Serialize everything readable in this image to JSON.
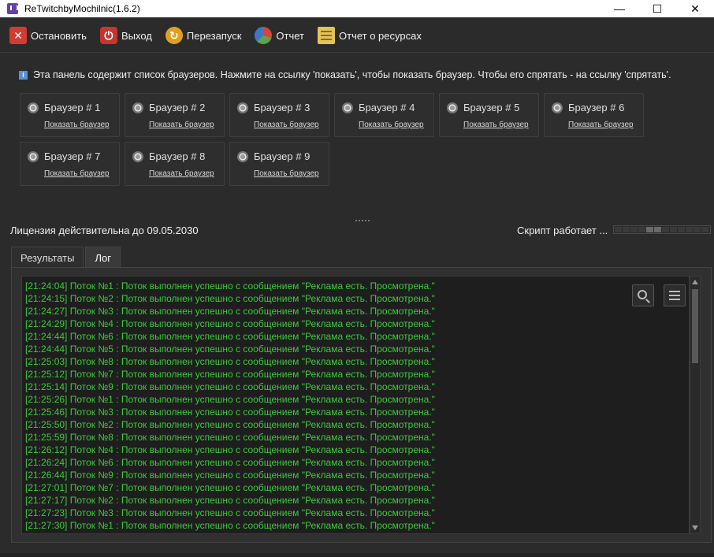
{
  "window": {
    "title": "ReTwitchbyMochilnic(1.6.2)",
    "controls": {
      "minimize": "—",
      "maximize": "☐",
      "close": "✕"
    }
  },
  "toolbar": {
    "stop": "Остановить",
    "exit": "Выход",
    "restart": "Перезапуск",
    "report": "Отчет",
    "resources": "Отчет о ресурсах"
  },
  "info": {
    "text": "Эта панель содержит список браузеров. Нажмите на ссылку 'показать', чтобы показать браузер. Чтобы его спрятать - на ссылку 'спрятать'."
  },
  "browsers": [
    {
      "name": "Браузер # 1",
      "link": "Показать браузер"
    },
    {
      "name": "Браузер # 2",
      "link": "Показать браузер"
    },
    {
      "name": "Браузер # 3",
      "link": "Показать браузер"
    },
    {
      "name": "Браузер # 4",
      "link": "Показать браузер"
    },
    {
      "name": "Браузер # 5",
      "link": "Показать браузер"
    },
    {
      "name": "Браузер # 6",
      "link": "Показать браузер"
    },
    {
      "name": "Браузер # 7",
      "link": "Показать браузер"
    },
    {
      "name": "Браузер # 8",
      "link": "Показать браузер"
    },
    {
      "name": "Браузер # 9",
      "link": "Показать браузер"
    }
  ],
  "status": {
    "license": "Лицензия действительна до 09.05.2030",
    "script": "Скрипт работает ..."
  },
  "tabs": [
    {
      "label": "Результаты",
      "active": false
    },
    {
      "label": "Лог",
      "active": true
    }
  ],
  "log": [
    "[21:24:04] Поток №1 : Поток выполнен успешно с сообщением \"Реклама есть. Просмотрена.\"",
    "[21:24:15] Поток №2 : Поток выполнен успешно с сообщением \"Реклама есть. Просмотрена.\"",
    "[21:24:27] Поток №3 : Поток выполнен успешно с сообщением \"Реклама есть. Просмотрена.\"",
    "[21:24:29] Поток №4 : Поток выполнен успешно с сообщением \"Реклама есть. Просмотрена.\"",
    "[21:24:44] Поток №6 : Поток выполнен успешно с сообщением \"Реклама есть. Просмотрена.\"",
    "[21:24:44] Поток №5 : Поток выполнен успешно с сообщением \"Реклама есть. Просмотрена.\"",
    "[21:25:03] Поток №8 : Поток выполнен успешно с сообщением \"Реклама есть. Просмотрена.\"",
    "[21:25:12] Поток №7 : Поток выполнен успешно с сообщением \"Реклама есть. Просмотрена.\"",
    "[21:25:14] Поток №9 : Поток выполнен успешно с сообщением \"Реклама есть. Просмотрена.\"",
    "[21:25:26] Поток №1 : Поток выполнен успешно с сообщением \"Реклама есть. Просмотрена.\"",
    "[21:25:46] Поток №3 : Поток выполнен успешно с сообщением \"Реклама есть. Просмотрена.\"",
    "[21:25:50] Поток №2 : Поток выполнен успешно с сообщением \"Реклама есть. Просмотрена.\"",
    "[21:25:59] Поток №8 : Поток выполнен успешно с сообщением \"Реклама есть. Просмотрена.\"",
    "[21:26:12] Поток №4 : Поток выполнен успешно с сообщением \"Реклама есть. Просмотрена.\"",
    "[21:26:24] Поток №6 : Поток выполнен успешно с сообщением \"Реклама есть. Просмотрена.\"",
    "[21:26:44] Поток №9 : Поток выполнен успешно с сообщением \"Реклама есть. Просмотрена.\"",
    "[21:27:01] Поток №7 : Поток выполнен успешно с сообщением \"Реклама есть. Просмотрена.\"",
    "[21:27:17] Поток №2 : Поток выполнен успешно с сообщением \"Реклама есть. Просмотрена.\"",
    "[21:27:23] Поток №3 : Поток выполнен успешно с сообщением \"Реклама есть. Просмотрена.\"",
    "[21:27:30] Поток №1 : Поток выполнен успешно с сообщением \"Реклама есть. Просмотрена.\""
  ],
  "colors": {
    "log_text": "#3ec93e",
    "background": "#2b2b2b",
    "log_background": "#1e1e1e"
  },
  "icons": {
    "stop": "close-x-icon",
    "exit": "power-icon",
    "restart": "restart-icon",
    "report": "pie-chart-icon",
    "resources": "list-document-icon",
    "browser": "chrome-icon",
    "search": "search-icon",
    "menu": "menu-icon"
  }
}
